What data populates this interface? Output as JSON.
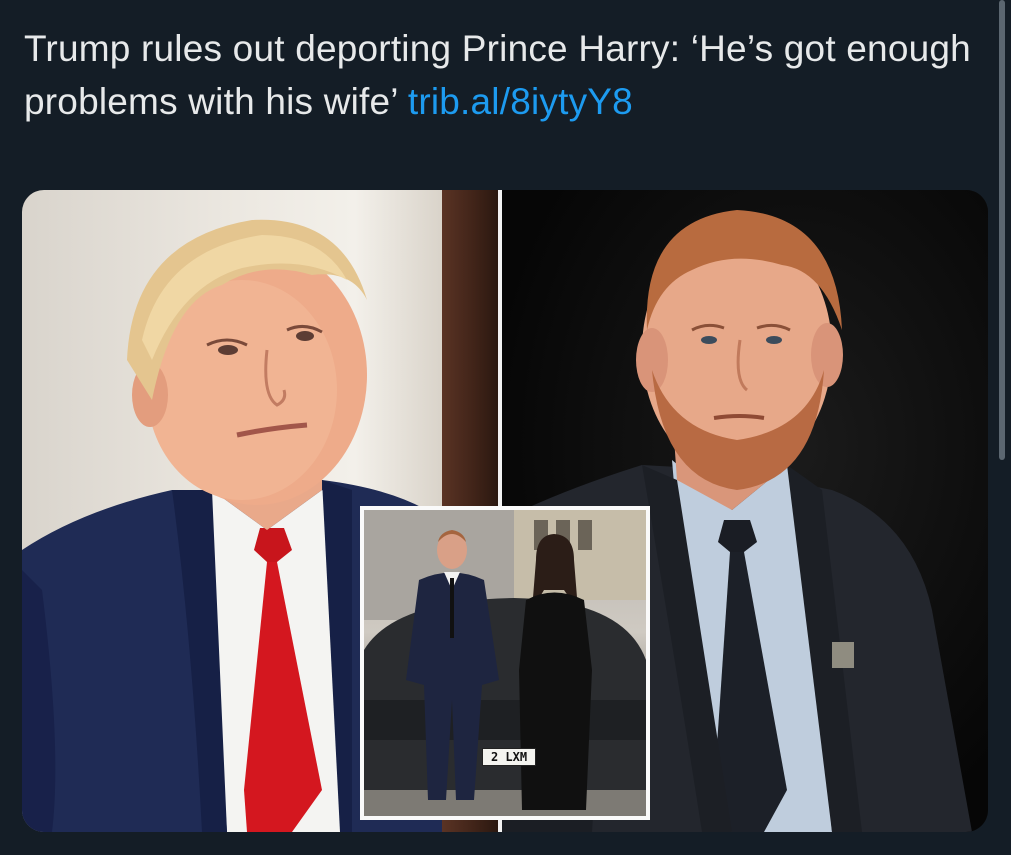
{
  "tweet": {
    "text": "Trump rules out deporting Prince Harry: ‘He’s got enough problems with his wife’",
    "link_text": "trib.al/8iytyY8"
  },
  "media": {
    "inset_plate_text": "2 LXM",
    "icons": [
      "photo-trump",
      "photo-harry",
      "photo-harry-meghan"
    ]
  },
  "colors": {
    "background": "#15202b",
    "text": "#e7e9ea",
    "link": "#1d9bf0"
  }
}
